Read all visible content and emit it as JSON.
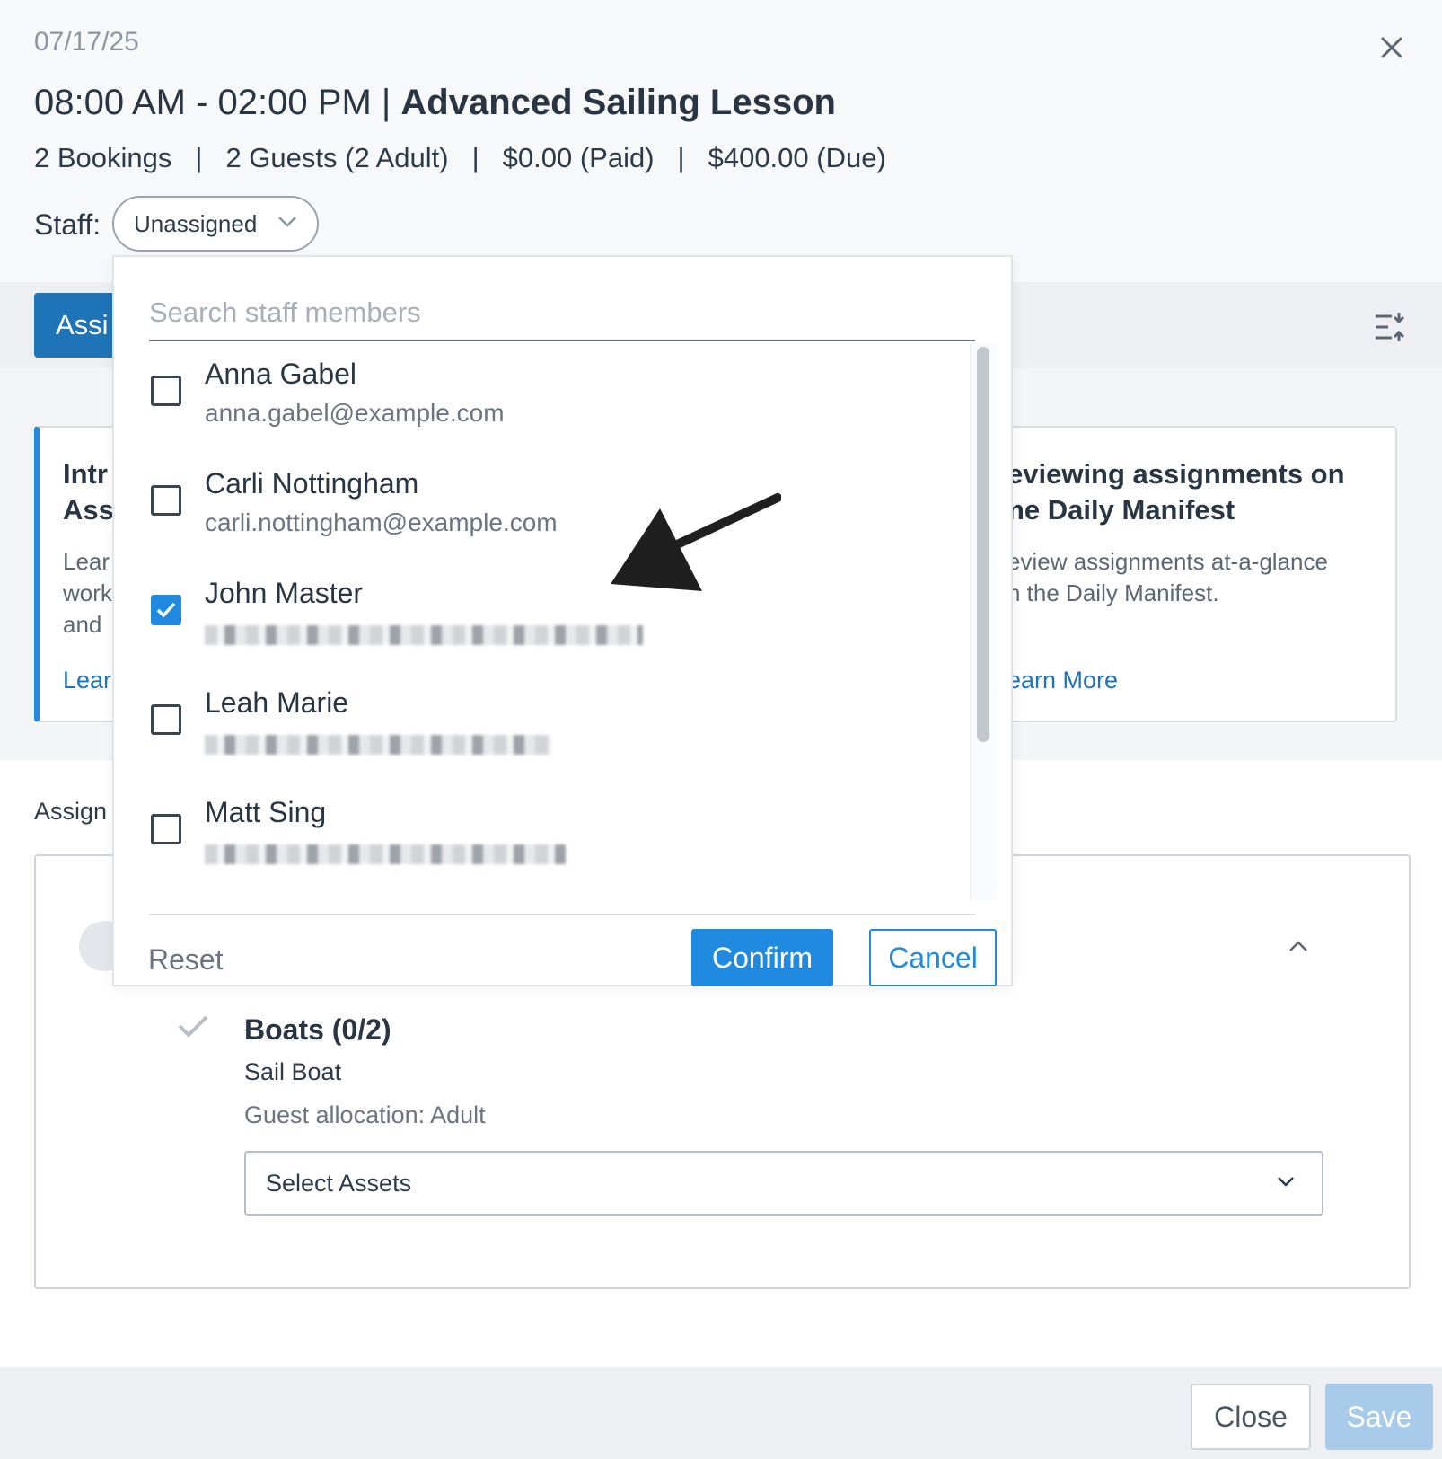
{
  "header": {
    "date": "07/17/25",
    "time_range": "08:00 AM - 02:00 PM | ",
    "title": "Advanced Sailing Lesson",
    "stats": [
      "2 Bookings",
      "2 Guests (2 Adult)",
      "$0.00 (Paid)",
      "$400.00 (Due)"
    ],
    "stats_separator": "|",
    "staff_label": "Staff:",
    "staff_value": "Unassigned"
  },
  "toolbar": {
    "assign_button": "Assi"
  },
  "cards": {
    "left": {
      "title_line1": "Intr",
      "title_line2": "Ass",
      "desc_line1": "Lear",
      "desc_line2": "work",
      "desc_line3": "and",
      "link": "Lear"
    },
    "right": {
      "title_line1": "eviewing assignments on",
      "title_line2": "ne Daily Manifest",
      "desc_line1": "eview assignments at-a-glance",
      "desc_line2": "n the Daily Manifest.",
      "link": "earn More"
    }
  },
  "assign_section_label": "Assign",
  "boats": {
    "title": "Boats (0/2)",
    "asset_type": "Sail Boat",
    "guest_allocation": "Guest allocation: Adult",
    "select_placeholder": "Select Assets"
  },
  "dropdown": {
    "search_placeholder": "Search staff members",
    "staff": [
      {
        "name": "Anna Gabel",
        "email": "anna.gabel@example.com",
        "checked": false,
        "email_redacted": false
      },
      {
        "name": "Carli Nottingham",
        "email": "carli.nottingham@example.com",
        "checked": false,
        "email_redacted": false
      },
      {
        "name": "John Master",
        "email": "",
        "checked": true,
        "email_redacted": true
      },
      {
        "name": "Leah Marie",
        "email": "",
        "checked": false,
        "email_redacted": true
      },
      {
        "name": "Matt Sing",
        "email": "",
        "checked": false,
        "email_redacted": true
      }
    ],
    "reset_label": "Reset",
    "confirm_label": "Confirm",
    "cancel_label": "Cancel"
  },
  "footer": {
    "close_label": "Close",
    "save_label": "Save"
  },
  "colors": {
    "primary": "#1f73b7",
    "accent": "#1f8ae0",
    "save_disabled": "#a7cbe8"
  }
}
